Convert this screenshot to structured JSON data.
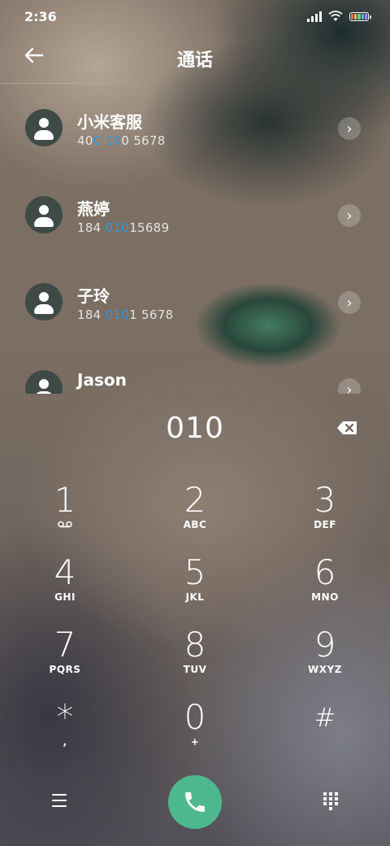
{
  "status_bar": {
    "time": "2:36"
  },
  "header": {
    "title": "通话"
  },
  "contacts": [
    {
      "name": "小米客服",
      "number_parts": [
        "40",
        "0",
        " ",
        "10",
        "0 5678"
      ]
    },
    {
      "name": "燕婷",
      "number_parts": [
        "184 ",
        "010",
        "",
        "",
        "15689"
      ]
    },
    {
      "name": "子玲",
      "number_parts": [
        "184 ",
        "010",
        "",
        "",
        "1 5678"
      ]
    },
    {
      "name": "Jason",
      "number_parts": [
        "",
        "",
        "",
        "",
        ""
      ]
    }
  ],
  "dialer": {
    "input": "010"
  },
  "keypad": [
    {
      "num": "1",
      "sub": "voicemail"
    },
    {
      "num": "2",
      "sub": "ABC"
    },
    {
      "num": "3",
      "sub": "DEF"
    },
    {
      "num": "4",
      "sub": "GHI"
    },
    {
      "num": "5",
      "sub": "JKL"
    },
    {
      "num": "6",
      "sub": "MNO"
    },
    {
      "num": "7",
      "sub": "PQRS"
    },
    {
      "num": "8",
      "sub": "TUV"
    },
    {
      "num": "9",
      "sub": "WXYZ"
    },
    {
      "num": "*",
      "sub": ","
    },
    {
      "num": "0",
      "sub": "+"
    },
    {
      "num": "#",
      "sub": ""
    }
  ],
  "icons": {
    "back": "arrow-left-icon",
    "chevron": "chevron-right-icon",
    "backspace": "backspace-icon",
    "menu": "menu-icon",
    "call": "phone-icon",
    "keypad_toggle": "dialpad-icon"
  },
  "colors": {
    "accent": "#2a9be6",
    "call_button": "#4db88f"
  }
}
